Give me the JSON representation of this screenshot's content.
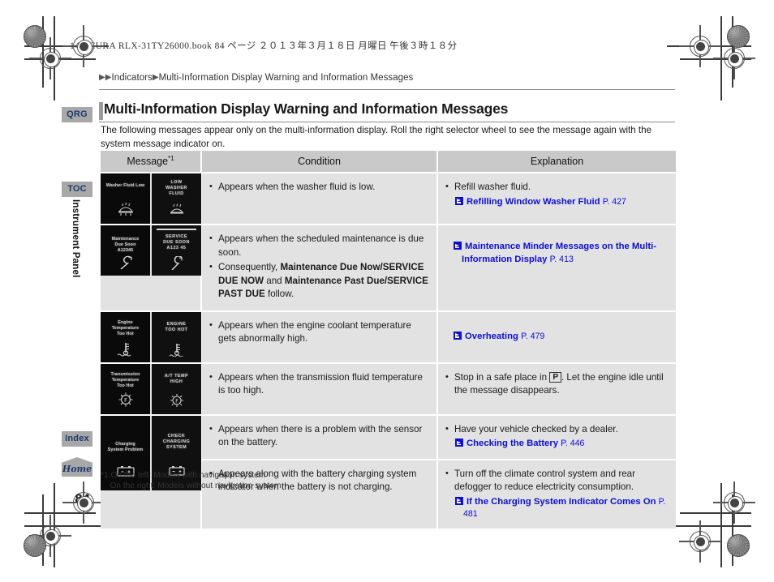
{
  "book_header": "14 ACURA RLX-31TY26000.book   84 ページ   ２０１３年３月１８日   月曜日   午後３時１８分",
  "breadcrumb": {
    "arrow": "▶",
    "level1": "Indicators",
    "level2": "Multi-Information Display Warning and Information Messages"
  },
  "page_title": "Multi-Information Display Warning and Information Messages",
  "intro": "The following messages appear only on the multi-information display. Roll the right selector wheel to see the message again with the system message indicator on.",
  "side_tabs": {
    "qrg": "QRG",
    "toc": "TOC",
    "index": "Index",
    "home": "Home",
    "section_label": "Instrument Panel"
  },
  "table": {
    "headers": {
      "message": "Message",
      "message_footnote": "*1",
      "condition": "Condition",
      "explanation": "Explanation"
    },
    "rows": [
      {
        "display_left": "Washer Fluid Low",
        "display_right": "LOW\nWASHER\nFLUID",
        "icon": "washer-fluid-icon",
        "condition": [
          {
            "text": "Appears when the washer fluid is low."
          }
        ],
        "explanation": [
          {
            "text": "Refill washer fluid.",
            "xref": "Refilling Window Washer Fluid",
            "page": "P. 427"
          }
        ]
      },
      {
        "display_left": "Maintenance\nDue Soon\nA12345",
        "display_right": "SERVICE\nDUE SOON\nA123 45",
        "icon": "wrench-icon",
        "condition": [
          {
            "text": "Appears when the scheduled maintenance is due soon."
          },
          {
            "prefix": "Consequently, ",
            "bold1": "Maintenance Due Now/SERVICE DUE NOW",
            "mid": " and ",
            "bold2": "Maintenance Past Due/SERVICE PAST DUE",
            "suffix": " follow."
          }
        ],
        "explanation": [
          {
            "text": "",
            "xref": "Maintenance Minder Messages on the Multi-Information Display",
            "page": "P. 413"
          }
        ]
      },
      {
        "display_left": "Engine\nTemperature\nToo Hot",
        "display_right": "ENGINE\nTOO HOT",
        "icon": "coolant-temp-icon",
        "condition": [
          {
            "text": "Appears when the engine coolant temperature gets abnormally high."
          }
        ],
        "explanation": [
          {
            "text": "",
            "xref": "Overheating",
            "page": "P. 479"
          }
        ]
      },
      {
        "display_left": "Transmission\nTemperature\nToo Hot",
        "display_right": "A/T TEMP\nHIGH",
        "icon": "at-temp-icon",
        "condition": [
          {
            "text": "Appears when the transmission fluid temperature is too high."
          }
        ],
        "explanation": [
          {
            "pre": "Stop in a safe place in ",
            "pbox": "P",
            "post": ". Let the engine idle until the message disappears."
          }
        ]
      },
      {
        "display_left": "Charging\nSystem Problem",
        "display_right": "CHECK\nCHARGING\nSYSTEM",
        "icon": "battery-icon",
        "condition": [
          {
            "text": "Appears when there is a problem with the sensor on the battery."
          }
        ],
        "explanation": [
          {
            "text": "Have your vehicle checked by a dealer.",
            "xref": "Checking the Battery",
            "page": "P. 446"
          }
        ],
        "condition2": [
          {
            "text": "Appears along with the battery charging system indicator when the battery is not charging."
          }
        ],
        "explanation2": [
          {
            "text": "Turn off the climate control system and rear defogger to reduce electricity consumption.",
            "xref": "If the Charging System Indicator Comes On",
            "page": "P. 481"
          }
        ]
      }
    ]
  },
  "footnote": "*1:On the left: Models with navigation system\n    On the right: Models without navigation system",
  "page_number": "84",
  "colors": {
    "link_blue": "#0d0dd6",
    "tab_gray": "#a8a8a8",
    "tab_text": "#1b3a6b",
    "header_gray": "#c9c9c9",
    "cell_gray": "#e2e2e2"
  }
}
